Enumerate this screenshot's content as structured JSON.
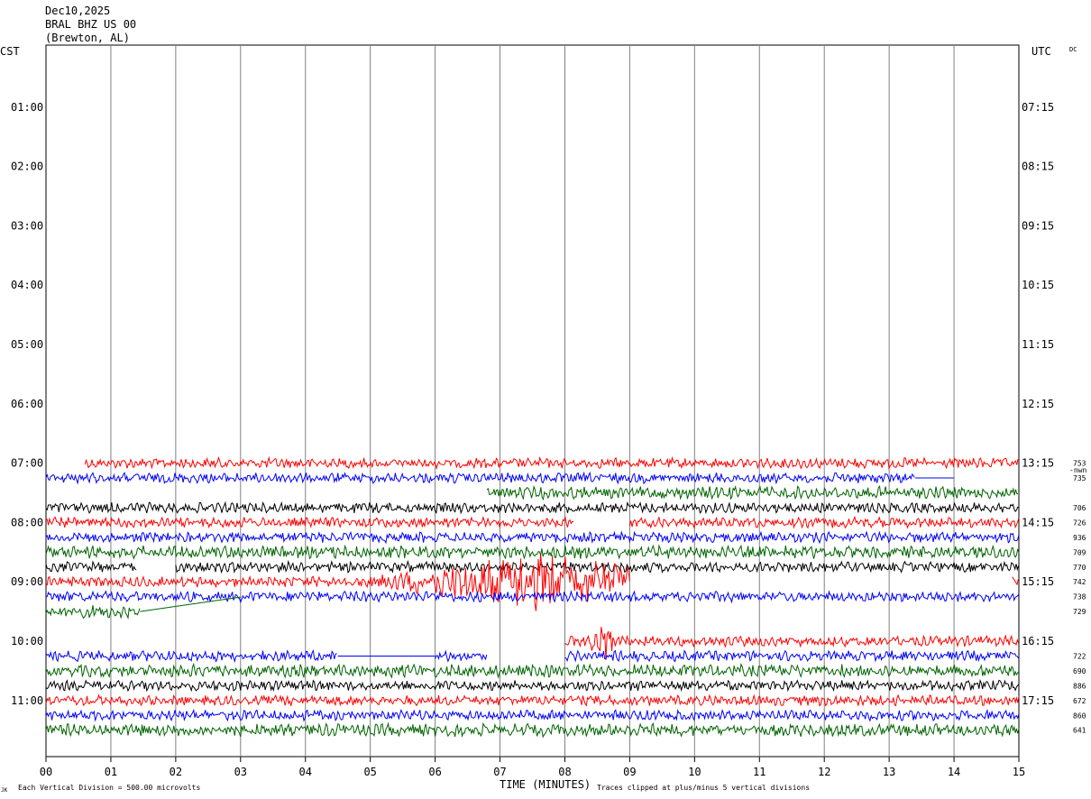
{
  "header": {
    "date": "Dec10,2025",
    "station": "BRAL BHZ US 00",
    "location": "(Brewton, AL)",
    "left_tz": "CST",
    "right_tz": "UTC",
    "dc_label": "DC"
  },
  "footer": {
    "corner_mark": "JK",
    "scale_note": "Each Vertical Division =  500.00 microvolts",
    "clip_note": "Traces clipped at plus/minus 5 vertical divisions"
  },
  "colors": {
    "red": "#ff0000",
    "blue": "#0000ff",
    "green": "#006400",
    "black": "#000000",
    "grid": "#808080"
  },
  "chart_data": {
    "type": "line",
    "title": "Dec10,2025 BRAL BHZ US 00 (Brewton, AL)",
    "xlabel": "TIME (MINUTES)",
    "xlim": [
      0,
      15
    ],
    "x_ticks": [
      "00",
      "01",
      "02",
      "03",
      "04",
      "05",
      "06",
      "07",
      "08",
      "09",
      "10",
      "11",
      "12",
      "13",
      "14",
      "15"
    ],
    "grid": true,
    "left_hour_labels": [
      "01:00",
      "02:00",
      "03:00",
      "04:00",
      "05:00",
      "06:00",
      "07:00",
      "08:00",
      "09:00",
      "10:00",
      "11:00"
    ],
    "right_hour_labels": [
      "07:15",
      "08:15",
      "09:15",
      "10:15",
      "11:15",
      "12:15",
      "13:15",
      "14:15",
      "15:15",
      "16:15",
      "17:15"
    ],
    "right_extra_label": "-nwn",
    "traces": [
      {
        "row": 28,
        "color": "red",
        "start": 0.6,
        "end": 15,
        "count": "753"
      },
      {
        "row": 29,
        "color": "blue",
        "start": 0,
        "end": 13.4,
        "count": "735",
        "gap_line_to": 14.0
      },
      {
        "row": 30,
        "color": "green",
        "start": 6.8,
        "end": 15,
        "count": ""
      },
      {
        "row": 31,
        "color": "black",
        "start": 0,
        "end": 15,
        "count": "706"
      },
      {
        "row": 32,
        "color": "red",
        "start": 0,
        "end": 8.15,
        "count": "726",
        "resume": 9.0
      },
      {
        "row": 33,
        "color": "blue",
        "start": 0,
        "end": 15,
        "count": "936"
      },
      {
        "row": 34,
        "color": "green",
        "start": 0,
        "end": 15,
        "count": "709"
      },
      {
        "row": 35,
        "color": "black",
        "start": 0,
        "end": 1.4,
        "count": "770",
        "resume": 2.0
      },
      {
        "row": 36,
        "color": "red",
        "start": 0,
        "end": 9.0,
        "count": "742",
        "quake": [
          5.0,
          9.0,
          7.6
        ],
        "resume": 14.9
      },
      {
        "row": 37,
        "color": "blue",
        "start": 0,
        "end": 15,
        "count": "738"
      },
      {
        "row": 38,
        "color": "green",
        "start": 0,
        "end": 1.45,
        "count": "729",
        "gap_line_to": 3.0
      },
      {
        "row": 40,
        "color": "red",
        "start": 8.0,
        "end": 15,
        "count": "",
        "burst": 8.6
      },
      {
        "row": 41,
        "color": "blue",
        "start": 0,
        "end": 4.5,
        "count": "722",
        "gap_line_to": 6.0,
        "resume_segment": [
          6.0,
          6.8
        ],
        "resume": 8.0
      },
      {
        "row": 42,
        "color": "green",
        "start": 0,
        "end": 15,
        "count": "690"
      },
      {
        "row": 43,
        "color": "black",
        "start": 0,
        "end": 15,
        "count": "886"
      },
      {
        "row": 44,
        "color": "red",
        "start": 0,
        "end": 15,
        "count": "672"
      },
      {
        "row": 45,
        "color": "blue",
        "start": 0,
        "end": 15,
        "count": "860"
      },
      {
        "row": 46,
        "color": "green",
        "start": 0,
        "end": 15,
        "count": "641"
      }
    ]
  }
}
